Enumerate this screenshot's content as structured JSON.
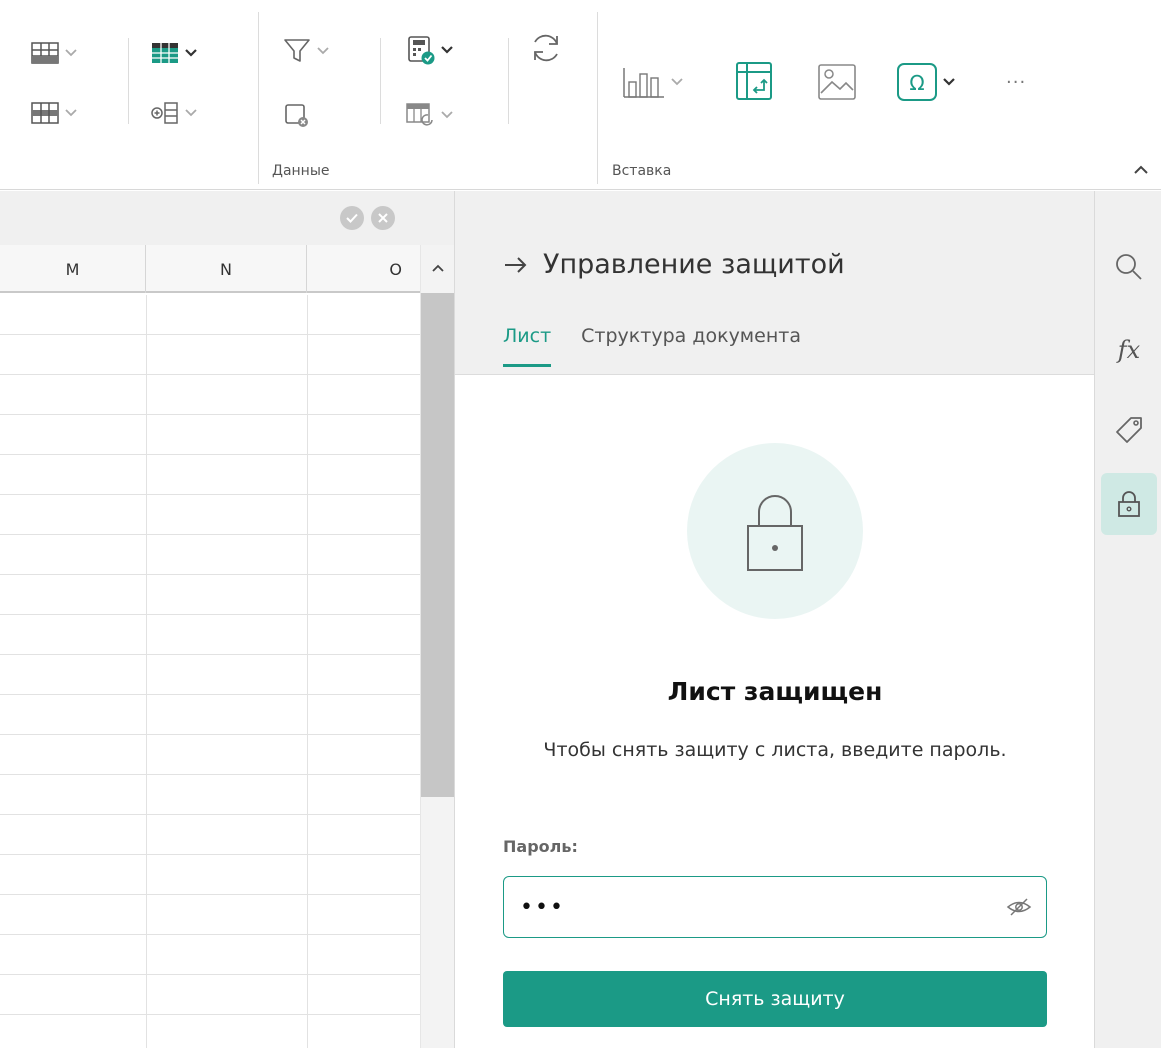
{
  "ribbon": {
    "groups": [
      {
        "label": "Данные"
      },
      {
        "label": "Вставка"
      }
    ],
    "overflow_label": "···"
  },
  "sheet": {
    "columns": [
      "M",
      "N",
      "O"
    ],
    "row_count": 19
  },
  "panel": {
    "title": "Управление защитой",
    "tabs": [
      {
        "label": "Лист",
        "active": true
      },
      {
        "label": "Структура документа",
        "active": false
      }
    ],
    "status_title": "Лист защищен",
    "status_description": "Чтобы снять защиту с листа, введите пароль.",
    "password_label": "Пароль:",
    "password_value": "•••",
    "unprotect_button": "Снять защиту"
  },
  "iconbar": {
    "items": [
      {
        "icon": "search-icon"
      },
      {
        "icon": "formula-icon",
        "label": "fx"
      },
      {
        "icon": "tag-icon"
      },
      {
        "icon": "lock-icon",
        "active": true
      }
    ]
  },
  "colors": {
    "accent": "#1b9a86",
    "accent_light": "#eaf5f3",
    "panel_bg": "#f0f0f0"
  }
}
